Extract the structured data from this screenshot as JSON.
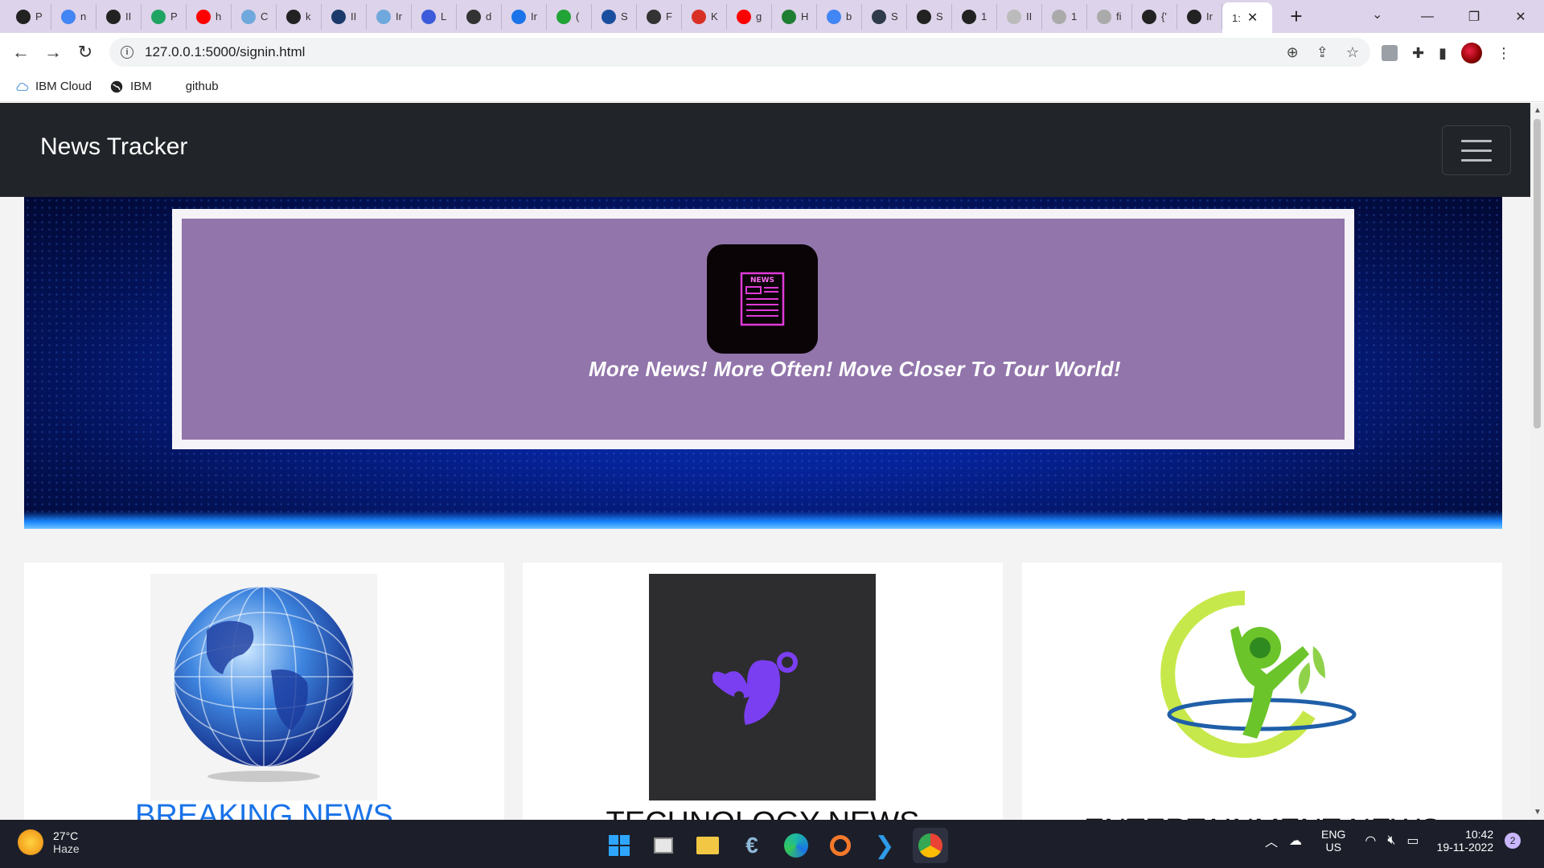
{
  "browser": {
    "tabs": [
      {
        "favicon": "globe-icon",
        "color": "#222",
        "label": "P"
      },
      {
        "favicon": "google-icon",
        "color": "#4285f4",
        "label": "n"
      },
      {
        "favicon": "globe-icon",
        "color": "#222",
        "label": "II"
      },
      {
        "favicon": "drive-icon",
        "color": "#1fa463",
        "label": "P"
      },
      {
        "favicon": "youtube-icon",
        "color": "#ff0000",
        "label": "h"
      },
      {
        "favicon": "cloud-icon",
        "color": "#6fa8dc",
        "label": "C"
      },
      {
        "favicon": "globe-icon",
        "color": "#222",
        "label": "k"
      },
      {
        "favicon": "grid-icon",
        "color": "#1b3a6b",
        "label": "II"
      },
      {
        "favicon": "cloud-icon",
        "color": "#6fa8dc",
        "label": "Ir"
      },
      {
        "favicon": "people-icon",
        "color": "#3b5bdb",
        "label": "L"
      },
      {
        "favicon": "bike-icon",
        "color": "#333",
        "label": "d"
      },
      {
        "favicon": "app-icon",
        "color": "#1a73e8",
        "label": "Ir"
      },
      {
        "favicon": "dollar-icon",
        "color": "#21a336",
        "label": "("
      },
      {
        "favicon": "shield-icon",
        "color": "#1a4fa0",
        "label": "S"
      },
      {
        "favicon": "globe-icon",
        "color": "#333",
        "label": "F"
      },
      {
        "favicon": "gmail-icon",
        "color": "#d93025",
        "label": "K"
      },
      {
        "favicon": "youtube-icon",
        "color": "#ff0000",
        "label": "g"
      },
      {
        "favicon": "w-icon",
        "color": "#1e7e34",
        "label": "H"
      },
      {
        "favicon": "google-icon",
        "color": "#4285f4",
        "label": "b"
      },
      {
        "favicon": "tds-icon",
        "color": "#2f3a4a",
        "label": "S"
      },
      {
        "favicon": "globe-icon",
        "color": "#222",
        "label": "S"
      },
      {
        "favicon": "globe-icon",
        "color": "#222",
        "label": "1"
      },
      {
        "favicon": "github-icon",
        "color": "#bbb",
        "label": "II"
      },
      {
        "favicon": "globe-icon",
        "color": "#aaa",
        "label": "1"
      },
      {
        "favicon": "globe-icon",
        "color": "#aaa",
        "label": "fi"
      },
      {
        "favicon": "globe-icon",
        "color": "#222",
        "label": "{'"
      },
      {
        "favicon": "globe-icon",
        "color": "#222",
        "label": "Ir"
      }
    ],
    "active_tab_label": "1:",
    "url": "127.0.0.1:5000/signin.html",
    "bookmarks": [
      {
        "icon": "cloud-icon",
        "label": "IBM Cloud"
      },
      {
        "icon": "globe-icon",
        "label": "IBM"
      },
      {
        "icon": "",
        "label": "github"
      }
    ]
  },
  "page": {
    "brand": "News Tracker",
    "hero": {
      "logo_text": "NEWS",
      "slogan": "More News! More Often! Move Closer To Tour World!"
    },
    "cards": [
      {
        "title": "BREAKING NEWS",
        "title_color": "#1a73e8"
      },
      {
        "title": "TECHNOLOGY NEWS",
        "title_color": "#111111"
      },
      {
        "title": "ENTERTAINMENT NEWS",
        "title_color": "#111111"
      }
    ]
  },
  "taskbar": {
    "weather_temp": "27°C",
    "weather_desc": "Haze",
    "lang_top": "ENG",
    "lang_bottom": "US",
    "time": "10:42",
    "date": "19-11-2022",
    "notification_count": "2"
  },
  "colors": {
    "navbar_bg": "#212529",
    "hero_card_bg": "#9275ab",
    "accent_link": "#1a73e8"
  }
}
